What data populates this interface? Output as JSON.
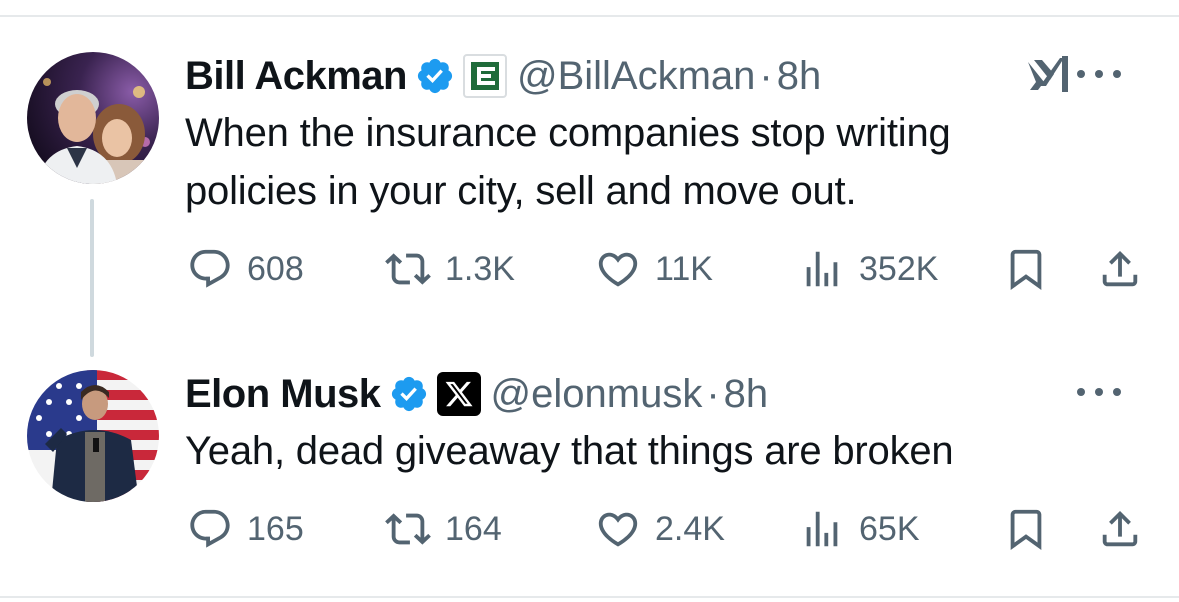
{
  "tweets": [
    {
      "author": "Bill Ackman",
      "handle": "@BillAckman",
      "separator": "·",
      "time": "8h",
      "text_lines": [
        "When the insurance companies stop writing",
        "policies in your city, sell and move out."
      ],
      "affiliate_badge": "pershing-square-logo",
      "stats": {
        "replies": "608",
        "reposts": "1.3K",
        "likes": "11K",
        "views": "352K"
      }
    },
    {
      "author": "Elon Musk",
      "handle": "@elonmusk",
      "separator": "·",
      "time": "8h",
      "text_lines": [
        "Yeah, dead giveaway that things are broken"
      ],
      "affiliate_badge": "x-logo",
      "stats": {
        "replies": "165",
        "reposts": "164",
        "likes": "2.4K",
        "views": "65K"
      }
    }
  ],
  "colors": {
    "verified": "#1d9bf0",
    "secondary_text": "#536471",
    "primary_text": "#0f1419",
    "thread_line": "#cfd9de",
    "divider": "#e6e9eb"
  },
  "icons": [
    "reply-icon",
    "repost-icon",
    "like-icon",
    "views-icon",
    "bookmark-icon",
    "share-icon",
    "more-icon",
    "grok-icon",
    "verified-badge-icon"
  ]
}
